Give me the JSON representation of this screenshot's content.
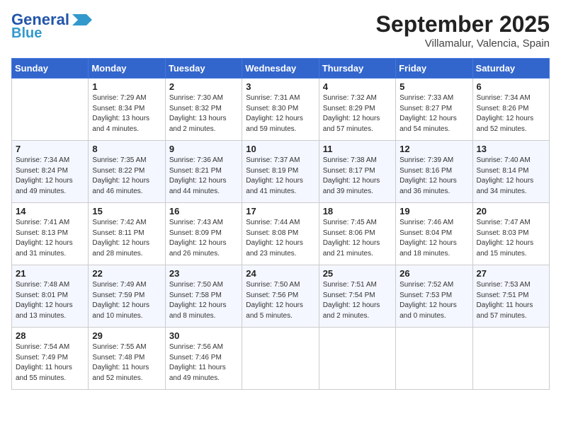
{
  "header": {
    "logo_line1": "General",
    "logo_line2": "Blue",
    "month": "September 2025",
    "location": "Villamalur, Valencia, Spain"
  },
  "weekdays": [
    "Sunday",
    "Monday",
    "Tuesday",
    "Wednesday",
    "Thursday",
    "Friday",
    "Saturday"
  ],
  "weeks": [
    [
      {
        "day": "",
        "info": ""
      },
      {
        "day": "1",
        "info": "Sunrise: 7:29 AM\nSunset: 8:34 PM\nDaylight: 13 hours\nand 4 minutes."
      },
      {
        "day": "2",
        "info": "Sunrise: 7:30 AM\nSunset: 8:32 PM\nDaylight: 13 hours\nand 2 minutes."
      },
      {
        "day": "3",
        "info": "Sunrise: 7:31 AM\nSunset: 8:30 PM\nDaylight: 12 hours\nand 59 minutes."
      },
      {
        "day": "4",
        "info": "Sunrise: 7:32 AM\nSunset: 8:29 PM\nDaylight: 12 hours\nand 57 minutes."
      },
      {
        "day": "5",
        "info": "Sunrise: 7:33 AM\nSunset: 8:27 PM\nDaylight: 12 hours\nand 54 minutes."
      },
      {
        "day": "6",
        "info": "Sunrise: 7:34 AM\nSunset: 8:26 PM\nDaylight: 12 hours\nand 52 minutes."
      }
    ],
    [
      {
        "day": "7",
        "info": "Sunrise: 7:34 AM\nSunset: 8:24 PM\nDaylight: 12 hours\nand 49 minutes."
      },
      {
        "day": "8",
        "info": "Sunrise: 7:35 AM\nSunset: 8:22 PM\nDaylight: 12 hours\nand 46 minutes."
      },
      {
        "day": "9",
        "info": "Sunrise: 7:36 AM\nSunset: 8:21 PM\nDaylight: 12 hours\nand 44 minutes."
      },
      {
        "day": "10",
        "info": "Sunrise: 7:37 AM\nSunset: 8:19 PM\nDaylight: 12 hours\nand 41 minutes."
      },
      {
        "day": "11",
        "info": "Sunrise: 7:38 AM\nSunset: 8:17 PM\nDaylight: 12 hours\nand 39 minutes."
      },
      {
        "day": "12",
        "info": "Sunrise: 7:39 AM\nSunset: 8:16 PM\nDaylight: 12 hours\nand 36 minutes."
      },
      {
        "day": "13",
        "info": "Sunrise: 7:40 AM\nSunset: 8:14 PM\nDaylight: 12 hours\nand 34 minutes."
      }
    ],
    [
      {
        "day": "14",
        "info": "Sunrise: 7:41 AM\nSunset: 8:13 PM\nDaylight: 12 hours\nand 31 minutes."
      },
      {
        "day": "15",
        "info": "Sunrise: 7:42 AM\nSunset: 8:11 PM\nDaylight: 12 hours\nand 28 minutes."
      },
      {
        "day": "16",
        "info": "Sunrise: 7:43 AM\nSunset: 8:09 PM\nDaylight: 12 hours\nand 26 minutes."
      },
      {
        "day": "17",
        "info": "Sunrise: 7:44 AM\nSunset: 8:08 PM\nDaylight: 12 hours\nand 23 minutes."
      },
      {
        "day": "18",
        "info": "Sunrise: 7:45 AM\nSunset: 8:06 PM\nDaylight: 12 hours\nand 21 minutes."
      },
      {
        "day": "19",
        "info": "Sunrise: 7:46 AM\nSunset: 8:04 PM\nDaylight: 12 hours\nand 18 minutes."
      },
      {
        "day": "20",
        "info": "Sunrise: 7:47 AM\nSunset: 8:03 PM\nDaylight: 12 hours\nand 15 minutes."
      }
    ],
    [
      {
        "day": "21",
        "info": "Sunrise: 7:48 AM\nSunset: 8:01 PM\nDaylight: 12 hours\nand 13 minutes."
      },
      {
        "day": "22",
        "info": "Sunrise: 7:49 AM\nSunset: 7:59 PM\nDaylight: 12 hours\nand 10 minutes."
      },
      {
        "day": "23",
        "info": "Sunrise: 7:50 AM\nSunset: 7:58 PM\nDaylight: 12 hours\nand 8 minutes."
      },
      {
        "day": "24",
        "info": "Sunrise: 7:50 AM\nSunset: 7:56 PM\nDaylight: 12 hours\nand 5 minutes."
      },
      {
        "day": "25",
        "info": "Sunrise: 7:51 AM\nSunset: 7:54 PM\nDaylight: 12 hours\nand 2 minutes."
      },
      {
        "day": "26",
        "info": "Sunrise: 7:52 AM\nSunset: 7:53 PM\nDaylight: 12 hours\nand 0 minutes."
      },
      {
        "day": "27",
        "info": "Sunrise: 7:53 AM\nSunset: 7:51 PM\nDaylight: 11 hours\nand 57 minutes."
      }
    ],
    [
      {
        "day": "28",
        "info": "Sunrise: 7:54 AM\nSunset: 7:49 PM\nDaylight: 11 hours\nand 55 minutes."
      },
      {
        "day": "29",
        "info": "Sunrise: 7:55 AM\nSunset: 7:48 PM\nDaylight: 11 hours\nand 52 minutes."
      },
      {
        "day": "30",
        "info": "Sunrise: 7:56 AM\nSunset: 7:46 PM\nDaylight: 11 hours\nand 49 minutes."
      },
      {
        "day": "",
        "info": ""
      },
      {
        "day": "",
        "info": ""
      },
      {
        "day": "",
        "info": ""
      },
      {
        "day": "",
        "info": ""
      }
    ]
  ]
}
